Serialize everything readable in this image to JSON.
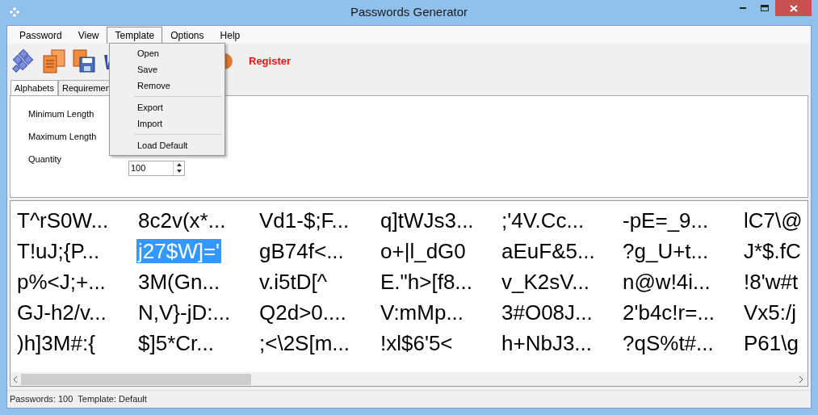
{
  "window": {
    "title": "Passwords Generator"
  },
  "menu_bar": [
    {
      "label": "Password",
      "selected": false
    },
    {
      "label": "View",
      "selected": false
    },
    {
      "label": "Template",
      "selected": true
    },
    {
      "label": "Options",
      "selected": false
    },
    {
      "label": "Help",
      "selected": false
    }
  ],
  "template_menu": [
    {
      "kind": "item",
      "label": "Open"
    },
    {
      "kind": "item",
      "label": "Save"
    },
    {
      "kind": "item",
      "label": "Remove"
    },
    {
      "kind": "separator"
    },
    {
      "kind": "item",
      "label": "Export"
    },
    {
      "kind": "item",
      "label": "Import"
    },
    {
      "kind": "separator"
    },
    {
      "kind": "item",
      "label": "Load Default"
    }
  ],
  "toolbar": {
    "register": "Register"
  },
  "tabs": [
    {
      "label": "Alphabets",
      "selected": true
    },
    {
      "label": "Requiremen",
      "selected": false
    }
  ],
  "settings": [
    {
      "label": "Minimum Length"
    },
    {
      "label": "Maximum Length"
    },
    {
      "label": "Quantity",
      "value": "100"
    }
  ],
  "passwords": [
    [
      {
        "text": "T^rS0W...",
        "selected": false
      },
      {
        "text": "8c2v(x*...",
        "selected": false
      },
      {
        "text": "Vd1-$;F...",
        "selected": false
      },
      {
        "text": "q]tWJs3...",
        "selected": false
      },
      {
        "text": ";'4V.Cc...",
        "selected": false
      },
      {
        "text": "-pE=_9...",
        "selected": false
      },
      {
        "text": "lC7\\@",
        "selected": false
      }
    ],
    [
      {
        "text": "T!uJ;{P...",
        "selected": false
      },
      {
        "text": "j27$W]='",
        "selected": true
      },
      {
        "text": "gB74f<...",
        "selected": false
      },
      {
        "text": "o+|l_dG0",
        "selected": false
      },
      {
        "text": "aEuF&5...",
        "selected": false
      },
      {
        "text": "?g_U+t...",
        "selected": false
      },
      {
        "text": "J*$.fC",
        "selected": false
      }
    ],
    [
      {
        "text": "p%<J;+...",
        "selected": false
      },
      {
        "text": "3M(Gn...",
        "selected": false
      },
      {
        "text": "v.i5tD[^",
        "selected": false
      },
      {
        "text": "E.\"h>[f8...",
        "selected": false
      },
      {
        "text": "v_K2sV...",
        "selected": false
      },
      {
        "text": "n@w!4i...",
        "selected": false
      },
      {
        "text": "!8'w#t",
        "selected": false
      }
    ],
    [
      {
        "text": "GJ-h2/v...",
        "selected": false
      },
      {
        "text": "N,V}-jD:...",
        "selected": false
      },
      {
        "text": "Q2d>0....",
        "selected": false
      },
      {
        "text": "V:mMp...",
        "selected": false
      },
      {
        "text": "3#O08J...",
        "selected": false
      },
      {
        "text": "2'b4c!r=...",
        "selected": false
      },
      {
        "text": "Vx5:/j",
        "selected": false
      }
    ],
    [
      {
        "text": ")h]3M#:{",
        "selected": false
      },
      {
        "text": "$]5*Cr...",
        "selected": false
      },
      {
        "text": ";<\\2S[m...",
        "selected": false
      },
      {
        "text": "!xl$6'5<",
        "selected": false
      },
      {
        "text": "h+NbJ3...",
        "selected": false
      },
      {
        "text": "?qS%t#...",
        "selected": false
      },
      {
        "text": "P61\\g",
        "selected": false
      }
    ]
  ],
  "status_bar": [
    "Passwords: 100",
    "Template: Default"
  ]
}
